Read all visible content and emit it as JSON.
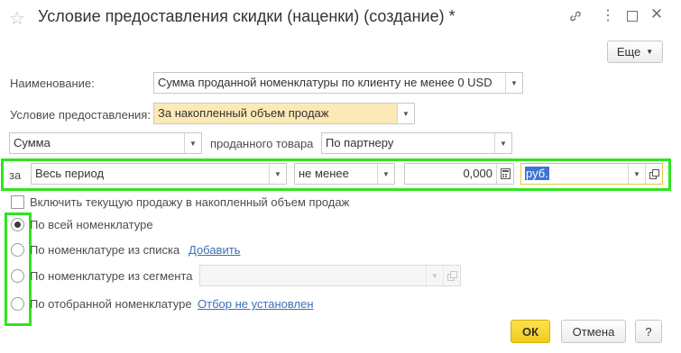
{
  "window": {
    "title": "Условие предоставления скидки (наценки) (создание) *",
    "more_button": "Еще",
    "icons": [
      "star-icon",
      "link-icon",
      "more-icon",
      "maximize-icon",
      "close-icon"
    ]
  },
  "form": {
    "name_label": "Наименование:",
    "name_value": "Сумма проданной номенклатуры по клиенту не менее 0 USD",
    "condition_label": "Условие предоставления:",
    "condition_value": "За накопленный объем продаж",
    "sum_value": "Сумма",
    "sold_goods_label": "проданного товара",
    "partner_value": "По партнеру",
    "period_prefix": "за",
    "period_value": "Весь период",
    "comparison_value": "не менее",
    "amount_value": "0,000",
    "currency_value": "руб.",
    "include_current_sale_label": "Включить текущую продажу в накопленный объем продаж"
  },
  "radio_options": {
    "all": "По всей номенклатуре",
    "from_list": "По номенклатуре из списка",
    "add_link": "Добавить",
    "from_segment": "По номенклатуре из сегмента",
    "selected_goods": "По отобранной номенклатуре",
    "filter_link": "Отбор не установлен",
    "selected": "all"
  },
  "footer": {
    "ok": "ОК",
    "cancel": "Отмена",
    "help": "?"
  },
  "colors": {
    "highlight_border": "#2ee51e",
    "ok_button": "#f5d32a",
    "required_field": "#fde9b5",
    "link": "#3c6fb6"
  }
}
